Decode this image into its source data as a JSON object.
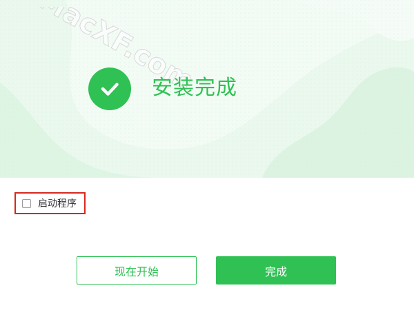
{
  "header": {
    "title": "安装完成",
    "status_icon": "check-circle-icon",
    "watermark_text": "MacXF.com"
  },
  "options": {
    "launch_label": "启动程序",
    "launch_checked": false
  },
  "actions": {
    "start_now_label": "现在开始",
    "finish_label": "完成"
  },
  "colors": {
    "accent": "#2fc153",
    "hero_background": "#eaf8ee",
    "highlight_border": "#d9261c"
  }
}
